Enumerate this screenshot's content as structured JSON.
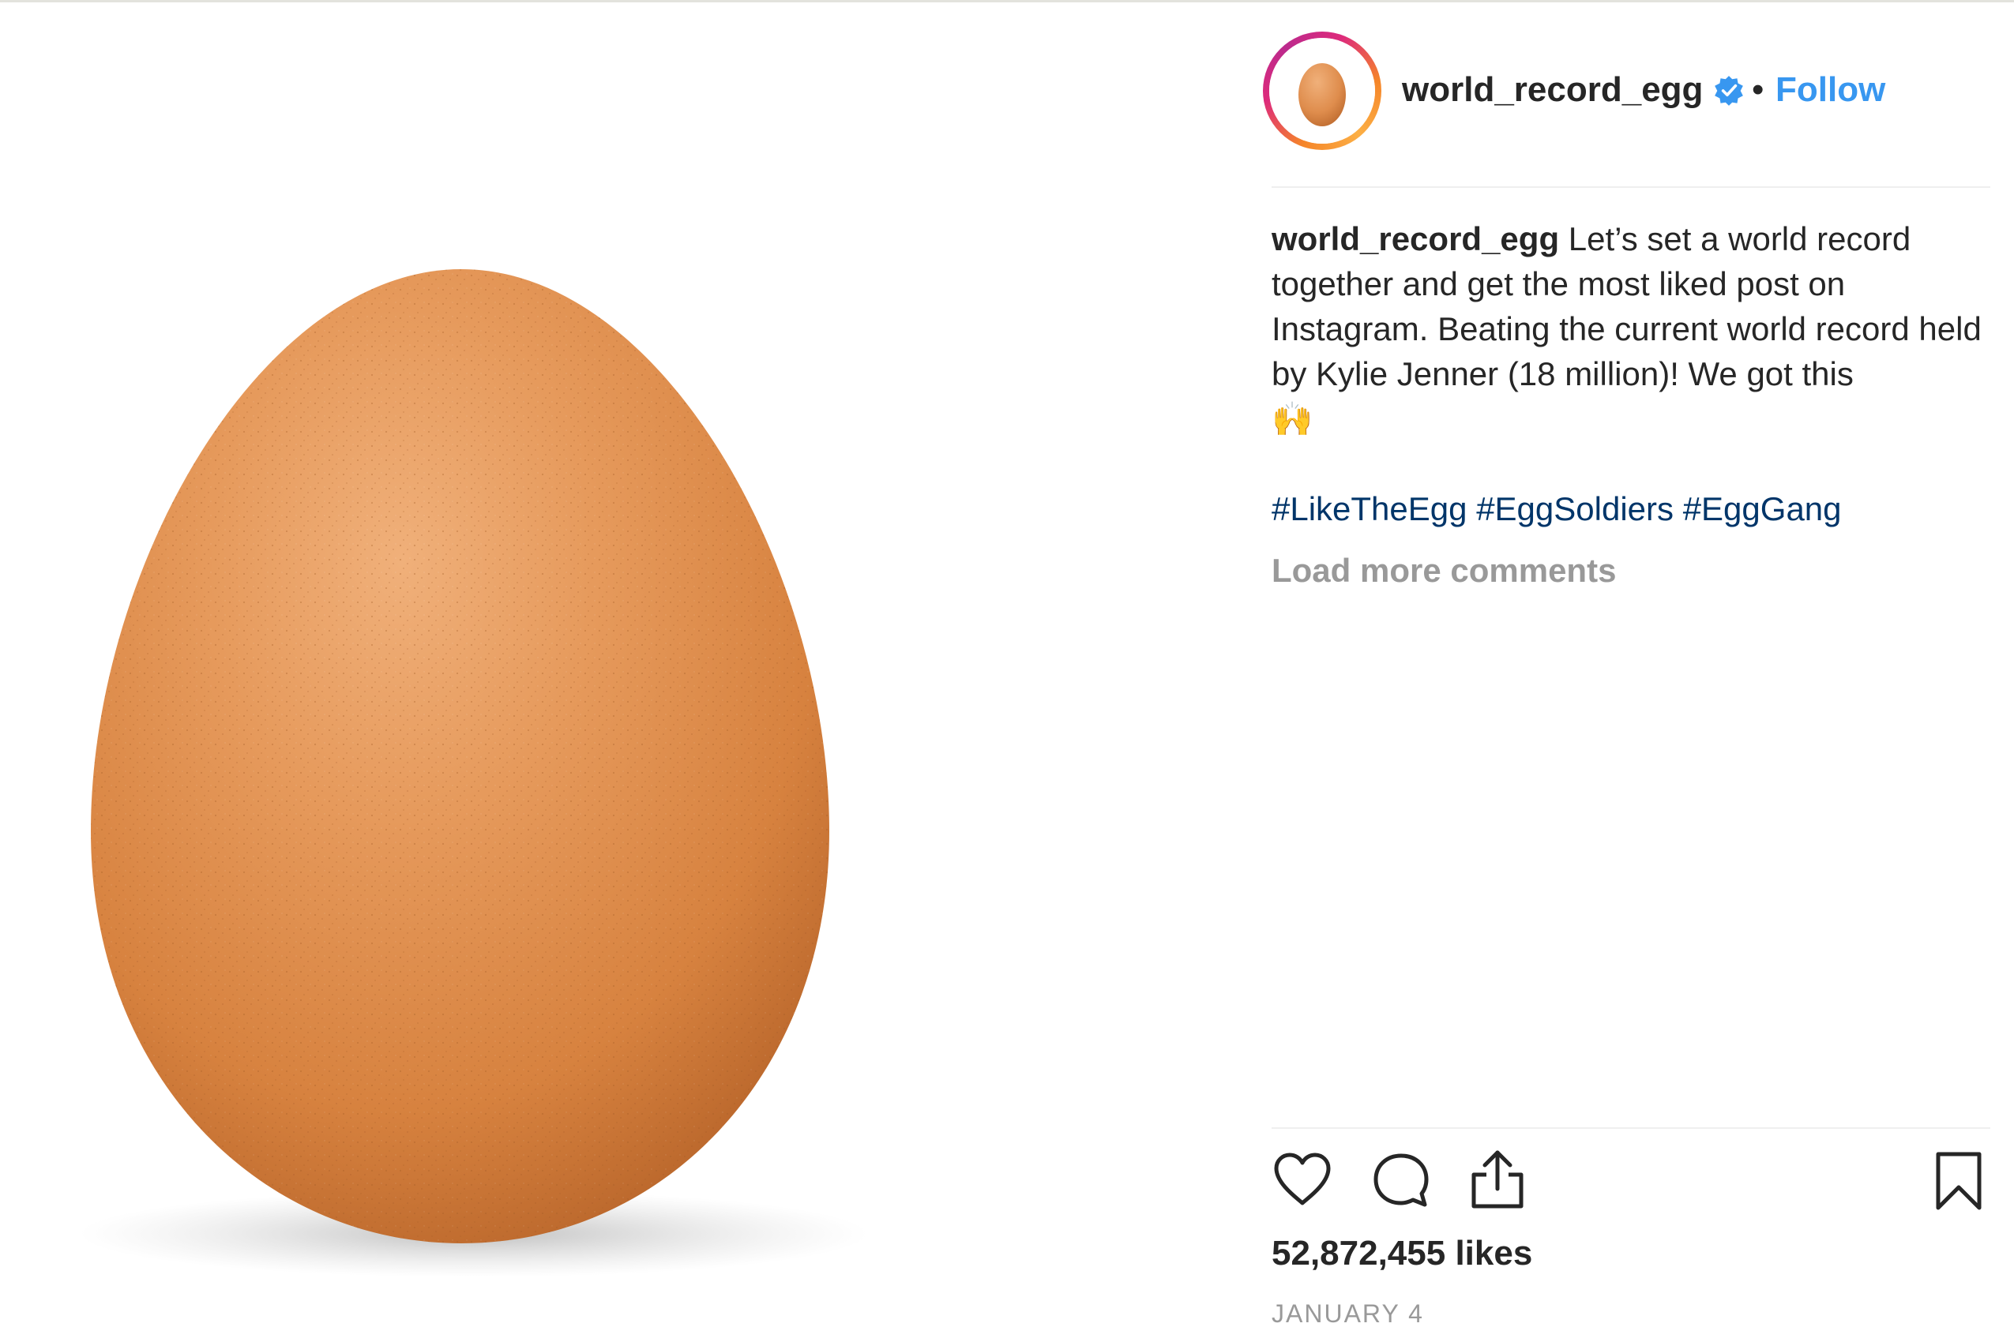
{
  "post": {
    "username": "world_record_egg",
    "follow_label": "Follow",
    "separator": "•",
    "caption_text": "Let’s set a world record together and get the most liked post on Instagram. Beating the current world record held by Kylie Jenner (18 million)! We got this",
    "caption_emoji": "🙌",
    "hashtags": [
      "#LikeTheEgg",
      "#EggSoldiers",
      "#EggGang"
    ],
    "load_more_label": "Load more comments",
    "likes_text": "52,872,455 likes",
    "date_text": "JANUARY 4"
  },
  "icons": {
    "verified": "verified-badge-icon",
    "like": "heart-icon",
    "comment": "comment-bubble-icon",
    "share": "share-icon",
    "save": "bookmark-icon"
  },
  "colors": {
    "link_blue": "#3897f0",
    "hashtag_blue": "#003569",
    "muted_gray": "#999999",
    "egg_orange": "#e08d4e"
  }
}
